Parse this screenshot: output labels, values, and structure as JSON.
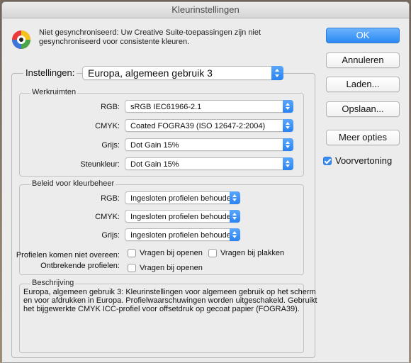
{
  "window": {
    "title": "Kleurinstellingen"
  },
  "warning": {
    "icon": "color-sync-warning-icon",
    "line1": "Niet gesynchroniseerd: Uw Creative Suite-toepassingen zijn niet",
    "line2": "gesynchroniseerd voor consistente kleuren."
  },
  "buttons": {
    "ok": "OK",
    "cancel": "Annuleren",
    "load": "Laden...",
    "save": "Opslaan...",
    "more_options": "Meer opties"
  },
  "preview": {
    "label": "Voorvertoning",
    "checked": true
  },
  "settings": {
    "label": "Instellingen:",
    "value": "Europa, algemeen gebruik 3"
  },
  "working_spaces": {
    "title": "Werkruimten",
    "rgb": {
      "label": "RGB:",
      "value": "sRGB IEC61966-2.1"
    },
    "cmyk": {
      "label": "CMYK:",
      "value": "Coated FOGRA39 (ISO 12647-2:2004)"
    },
    "gray": {
      "label": "Grijs:",
      "value": "Dot Gain 15%"
    },
    "spot": {
      "label": "Steunkleur:",
      "value": "Dot Gain 15%"
    }
  },
  "color_management": {
    "title": "Beleid voor kleurbeheer",
    "rgb": {
      "label": "RGB:",
      "value": "Ingesloten profielen behouden"
    },
    "cmyk": {
      "label": "CMYK:",
      "value": "Ingesloten profielen behouden"
    },
    "gray": {
      "label": "Grijs:",
      "value": "Ingesloten profielen behouden"
    },
    "mismatch_label": "Profielen komen niet overeen:",
    "ask_open": "Vragen bij openen",
    "ask_paste": "Vragen bij plakken",
    "missing_label": "Ontbrekende profielen:",
    "ask_open_missing": "Vragen bij openen"
  },
  "description": {
    "title": "Beschrijving",
    "line1": "Europa, algemeen gebruik 3:  Kleurinstellingen voor algemeen gebruik op het scherm",
    "line2": "en voor afdrukken in Europa. Profielwaarschuwingen worden uitgeschakeld. Gebruikt",
    "line3": "het bijgewerkte CMYK ICC-profiel voor offsetdruk op  gecoat papier (FOGRA39)."
  },
  "colors": {
    "accent": "#2b8af5",
    "window_bg": "#ececec"
  }
}
